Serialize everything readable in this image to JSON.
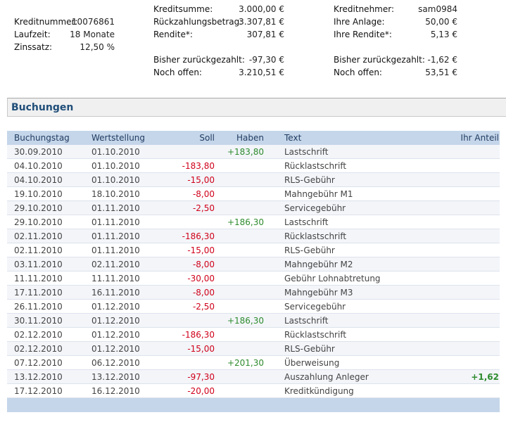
{
  "summary": {
    "col1": [
      {
        "label": "Kreditnummer:",
        "value": "10076861"
      },
      {
        "label": "Laufzeit:",
        "value": "18 Monate"
      },
      {
        "label": "Zinssatz:",
        "value": "12,50 %"
      }
    ],
    "col2": [
      {
        "label": "Kreditsumme:",
        "value": "3.000,00 €"
      },
      {
        "label": "Rückzahlungsbetrag:",
        "value": "3.307,81 €"
      },
      {
        "label": "Rendite*:",
        "value": "307,81 €"
      },
      {
        "label": "Bisher zurückgezahlt:",
        "value": "-97,30 €"
      },
      {
        "label": "Noch offen:",
        "value": "3.210,51 €"
      }
    ],
    "col3": [
      {
        "label": "Kreditnehmer:",
        "value": "sam0984"
      },
      {
        "label": "Ihre Anlage:",
        "value": "50,00 €"
      },
      {
        "label": "Ihre Rendite*:",
        "value": "5,13 €"
      },
      {
        "label": "Bisher zurückgezahlt:",
        "value": "-1,62 €"
      },
      {
        "label": "Noch offen:",
        "value": "53,51 €"
      }
    ]
  },
  "section_title": "Buchungen",
  "table": {
    "headers": {
      "buchungstag": "Buchungstag",
      "wertstellung": "Wertstellung",
      "soll": "Soll",
      "haben": "Haben",
      "text": "Text",
      "anteil": "Ihr Anteil"
    },
    "rows": [
      {
        "bt": "30.09.2010",
        "ws": "01.10.2010",
        "soll": "",
        "haben": "+183,80",
        "text": "Lastschrift",
        "anteil": ""
      },
      {
        "bt": "04.10.2010",
        "ws": "01.10.2010",
        "soll": "-183,80",
        "haben": "",
        "text": "Rücklastschrift",
        "anteil": ""
      },
      {
        "bt": "04.10.2010",
        "ws": "01.10.2010",
        "soll": "-15,00",
        "haben": "",
        "text": "RLS-Gebühr",
        "anteil": ""
      },
      {
        "bt": "19.10.2010",
        "ws": "18.10.2010",
        "soll": "-8,00",
        "haben": "",
        "text": "Mahngebühr M1",
        "anteil": ""
      },
      {
        "bt": "29.10.2010",
        "ws": "01.11.2010",
        "soll": "-2,50",
        "haben": "",
        "text": "Servicegebühr",
        "anteil": ""
      },
      {
        "bt": "29.10.2010",
        "ws": "01.11.2010",
        "soll": "",
        "haben": "+186,30",
        "text": "Lastschrift",
        "anteil": ""
      },
      {
        "bt": "02.11.2010",
        "ws": "01.11.2010",
        "soll": "-186,30",
        "haben": "",
        "text": "Rücklastschrift",
        "anteil": ""
      },
      {
        "bt": "02.11.2010",
        "ws": "01.11.2010",
        "soll": "-15,00",
        "haben": "",
        "text": "RLS-Gebühr",
        "anteil": ""
      },
      {
        "bt": "03.11.2010",
        "ws": "02.11.2010",
        "soll": "-8,00",
        "haben": "",
        "text": "Mahngebühr M2",
        "anteil": ""
      },
      {
        "bt": "11.11.2010",
        "ws": "11.11.2010",
        "soll": "-30,00",
        "haben": "",
        "text": "Gebühr Lohnabtretung",
        "anteil": ""
      },
      {
        "bt": "17.11.2010",
        "ws": "16.11.2010",
        "soll": "-8,00",
        "haben": "",
        "text": "Mahngebühr M3",
        "anteil": ""
      },
      {
        "bt": "26.11.2010",
        "ws": "01.12.2010",
        "soll": "-2,50",
        "haben": "",
        "text": "Servicegebühr",
        "anteil": ""
      },
      {
        "bt": "30.11.2010",
        "ws": "01.12.2010",
        "soll": "",
        "haben": "+186,30",
        "text": "Lastschrift",
        "anteil": ""
      },
      {
        "bt": "02.12.2010",
        "ws": "01.12.2010",
        "soll": "-186,30",
        "haben": "",
        "text": "Rücklastschrift",
        "anteil": ""
      },
      {
        "bt": "02.12.2010",
        "ws": "01.12.2010",
        "soll": "-15,00",
        "haben": "",
        "text": "RLS-Gebühr",
        "anteil": ""
      },
      {
        "bt": "07.12.2010",
        "ws": "06.12.2010",
        "soll": "",
        "haben": "+201,30",
        "text": "Überweisung",
        "anteil": ""
      },
      {
        "bt": "13.12.2010",
        "ws": "13.12.2010",
        "soll": "-97,30",
        "haben": "",
        "text": "Auszahlung Anleger",
        "anteil": "+1,62"
      },
      {
        "bt": "17.12.2010",
        "ws": "16.12.2010",
        "soll": "-20,00",
        "haben": "",
        "text": "Kreditkündigung",
        "anteil": ""
      }
    ]
  },
  "colors": {
    "negative": "#d0021b",
    "positive": "#2e8b2e",
    "header_bg": "#c5d6ea",
    "title": "#1f4e79"
  }
}
